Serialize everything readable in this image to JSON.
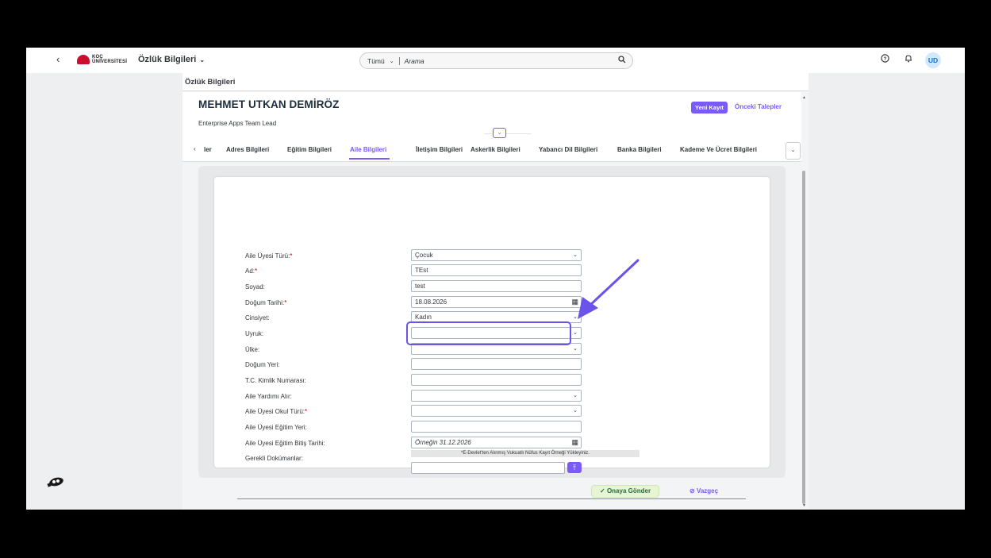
{
  "shell": {
    "back_icon": "chevron-left-icon",
    "logo_text_line1": "KOÇ",
    "logo_text_line2": "ÜNİVERSİTESİ",
    "app_title": "Özlük Bilgileri",
    "search_scope": "Tümü",
    "search_placeholder": "Arama",
    "avatar_initials": "UD"
  },
  "page": {
    "title": "Özlük Bilgileri"
  },
  "header": {
    "name": "MEHMET UTKAN DEMİRÖZ",
    "role": "Enterprise Apps Team Lead",
    "new_record": "Yeni Kayıt",
    "previous_requests": "Önceki Talepler"
  },
  "tabs": [
    {
      "label": "ler"
    },
    {
      "label": "Adres Bilgileri"
    },
    {
      "label": "Eğitim Bilgileri"
    },
    {
      "label": "Aile Bilgileri"
    },
    {
      "label": "İletişim Bilgileri"
    },
    {
      "label": "Askerlik Bilgileri"
    },
    {
      "label": "Yabancı Dil Bilgileri"
    },
    {
      "label": "Banka Bilgileri"
    },
    {
      "label": "Kademe Ve Ücret Bilgileri"
    }
  ],
  "form": {
    "fields": [
      {
        "label": "Aile Üyesi Türü:",
        "required": true,
        "value": "Çocuk",
        "type": "select"
      },
      {
        "label": "Ad:",
        "required": true,
        "value": "TEst",
        "type": "text"
      },
      {
        "label": "Soyad:",
        "required": false,
        "value": "test",
        "type": "text"
      },
      {
        "label": "Doğum Tarihi:",
        "required": true,
        "value": "18.08.2026",
        "type": "date"
      },
      {
        "label": "Cinsiyet:",
        "required": false,
        "value": "Kadın",
        "type": "select"
      },
      {
        "label": "Uyruk:",
        "required": false,
        "value": "",
        "type": "select"
      },
      {
        "label": "Ülke:",
        "required": false,
        "value": "",
        "type": "select"
      },
      {
        "label": "Doğum Yeri:",
        "required": false,
        "value": "",
        "type": "text"
      },
      {
        "label": "T.C. Kimlik Numarası:",
        "required": false,
        "value": "",
        "type": "text"
      },
      {
        "label": "Aile Yardımı Alır:",
        "required": false,
        "value": "",
        "type": "select"
      },
      {
        "label": "Aile Üyesi Okul Türü:",
        "required": true,
        "value": "",
        "type": "select"
      },
      {
        "label": "Aile Üyesi Eğitim Yeri:",
        "required": false,
        "value": "",
        "type": "text"
      },
      {
        "label": "Aile Üyesi Eğitim Bitiş Tarihi:",
        "required": false,
        "placeholder": "Örneğin 31.12.2026",
        "type": "date"
      },
      {
        "label": "Gerekli Dokümanlar:",
        "required": false,
        "value": "",
        "type": "file"
      }
    ],
    "required_mark": "*",
    "documents_hint": "*E-Devlet'ten Alınmış Vukuatlı Nüfus Kayıt Örneği Yükleyiniz.",
    "submit_label": "Onaya Gönder",
    "cancel_label": "Vazgeç"
  },
  "colors": {
    "accent": "#7a5af8",
    "required": "#bb0000",
    "approve_bg": "#e8f5d5"
  }
}
